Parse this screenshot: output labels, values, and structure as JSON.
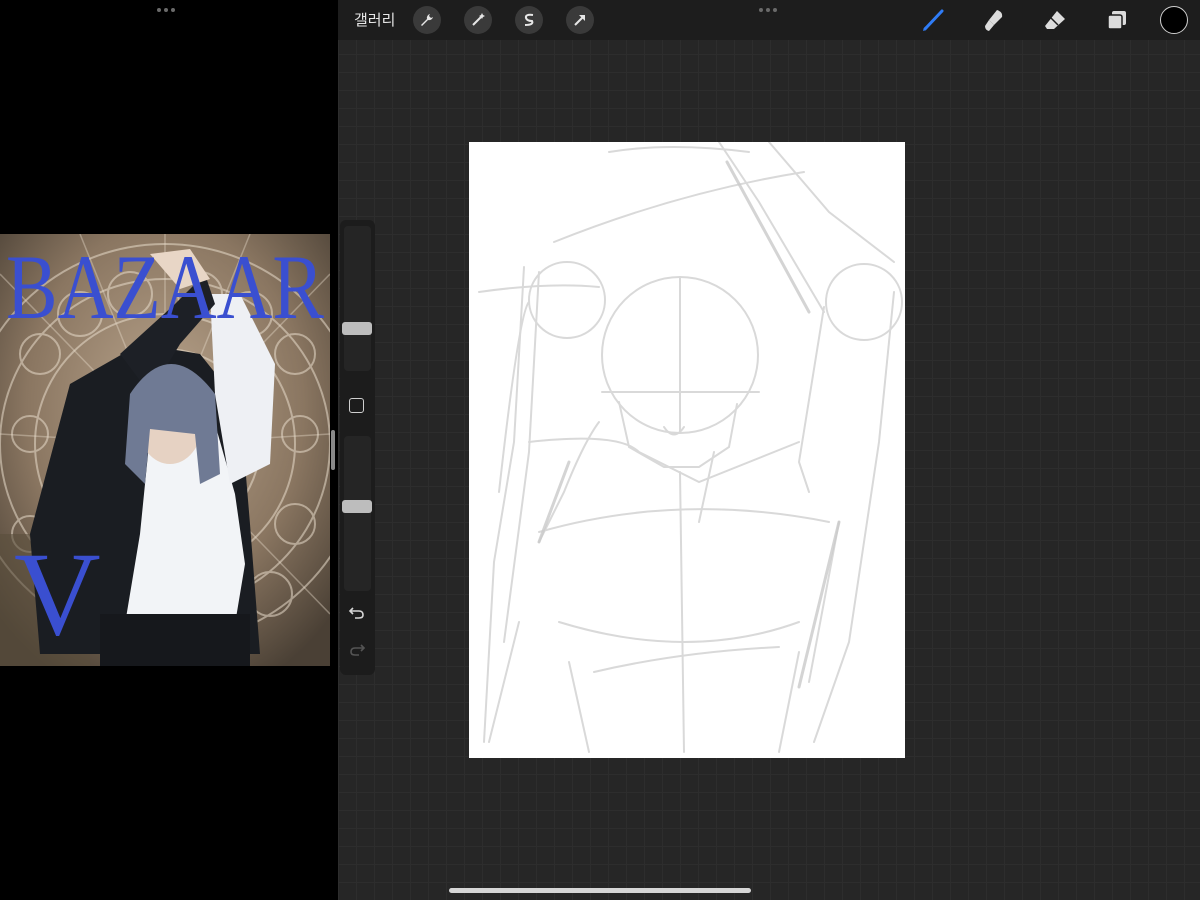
{
  "topbar": {
    "gallery_label": "갤러리",
    "tools_left": [
      "wrench-icon",
      "magic-wand-icon",
      "selection-s-icon",
      "transform-arrow-icon"
    ],
    "tools_right": [
      "brush-icon",
      "smudge-icon",
      "eraser-icon",
      "layers-icon"
    ],
    "active_tool": "brush-icon",
    "active_color": "#2f7cf6",
    "current_color": "#000000"
  },
  "reference": {
    "magazine_title": "BAZAAR",
    "side_letter": "V",
    "title_color": "#3a4fd0"
  },
  "sidebar": {
    "brush_size_level": 0.3,
    "opacity_level": 0.55,
    "undo_icon": "undo-arrow-icon",
    "redo_icon": "redo-arrow-icon"
  }
}
